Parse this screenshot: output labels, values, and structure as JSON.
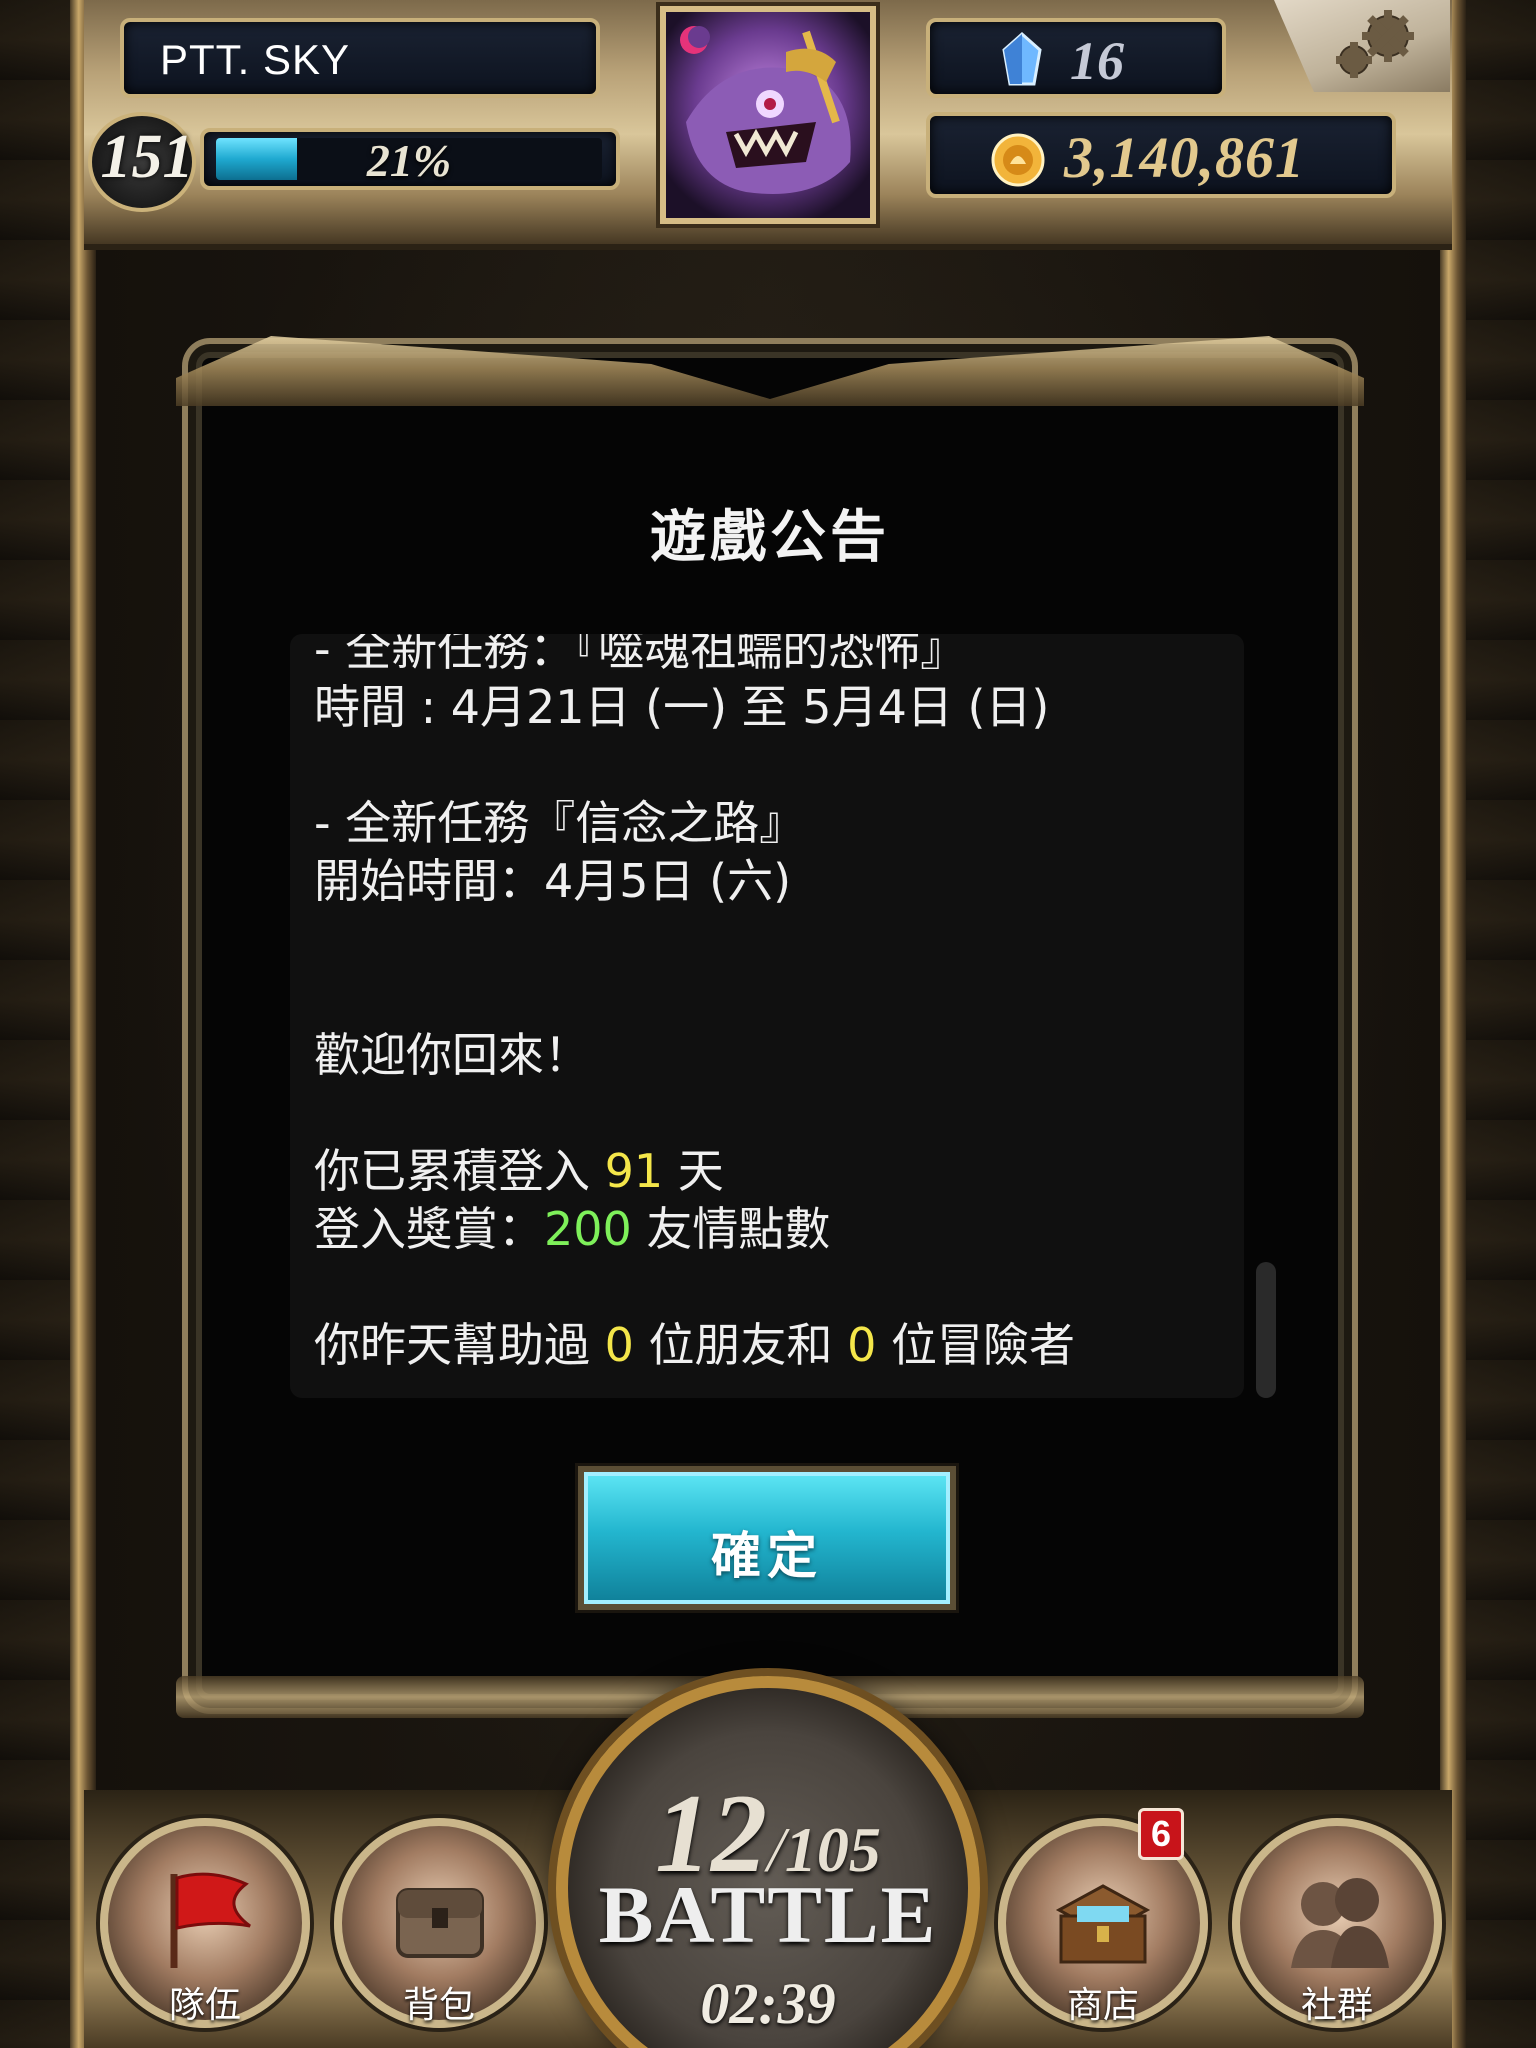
{
  "hud": {
    "player_name": "PTT. SKY",
    "level": "151",
    "xp_percent_text": "21%",
    "xp_progress": 0.21,
    "gems": "16",
    "coins": "3,140,861"
  },
  "dialog": {
    "title": "遊戲公告",
    "lines": {
      "l1": " - 全新任務：『噬魂祖蠕的恐怖』",
      "l2": "時間 : 4月21日 (一) 至 5月4日 (日)",
      "l3": " - 全新任務『信念之路』",
      "l4": "開始時間：4月5日 (六)",
      "l5": "歡迎你回來！",
      "l6_pre": "你已累積登入 ",
      "l6_days": "91",
      "l6_post": " 天",
      "l7_pre": "登入獎賞：",
      "l7_points": "200",
      "l7_post": " 友情點數",
      "l8_pre": "你昨天幫助過 ",
      "l8_friends": "0",
      "l8_mid": " 位朋友和 ",
      "l8_adventurers": "0",
      "l8_post": " 位冒險者"
    },
    "confirm_label": "確定"
  },
  "battle": {
    "stamina_current": "12",
    "stamina_sep": "/",
    "stamina_max": "105",
    "label": "BATTLE",
    "timer": "02:39"
  },
  "nav": {
    "team": "隊伍",
    "bag": "背包",
    "shop": "商店",
    "shop_badge": "6",
    "social": "社群"
  },
  "colors": {
    "highlight_yellow": "#f4e64a",
    "highlight_green": "#7ef05a",
    "confirm_cyan": "#23b6cf"
  }
}
